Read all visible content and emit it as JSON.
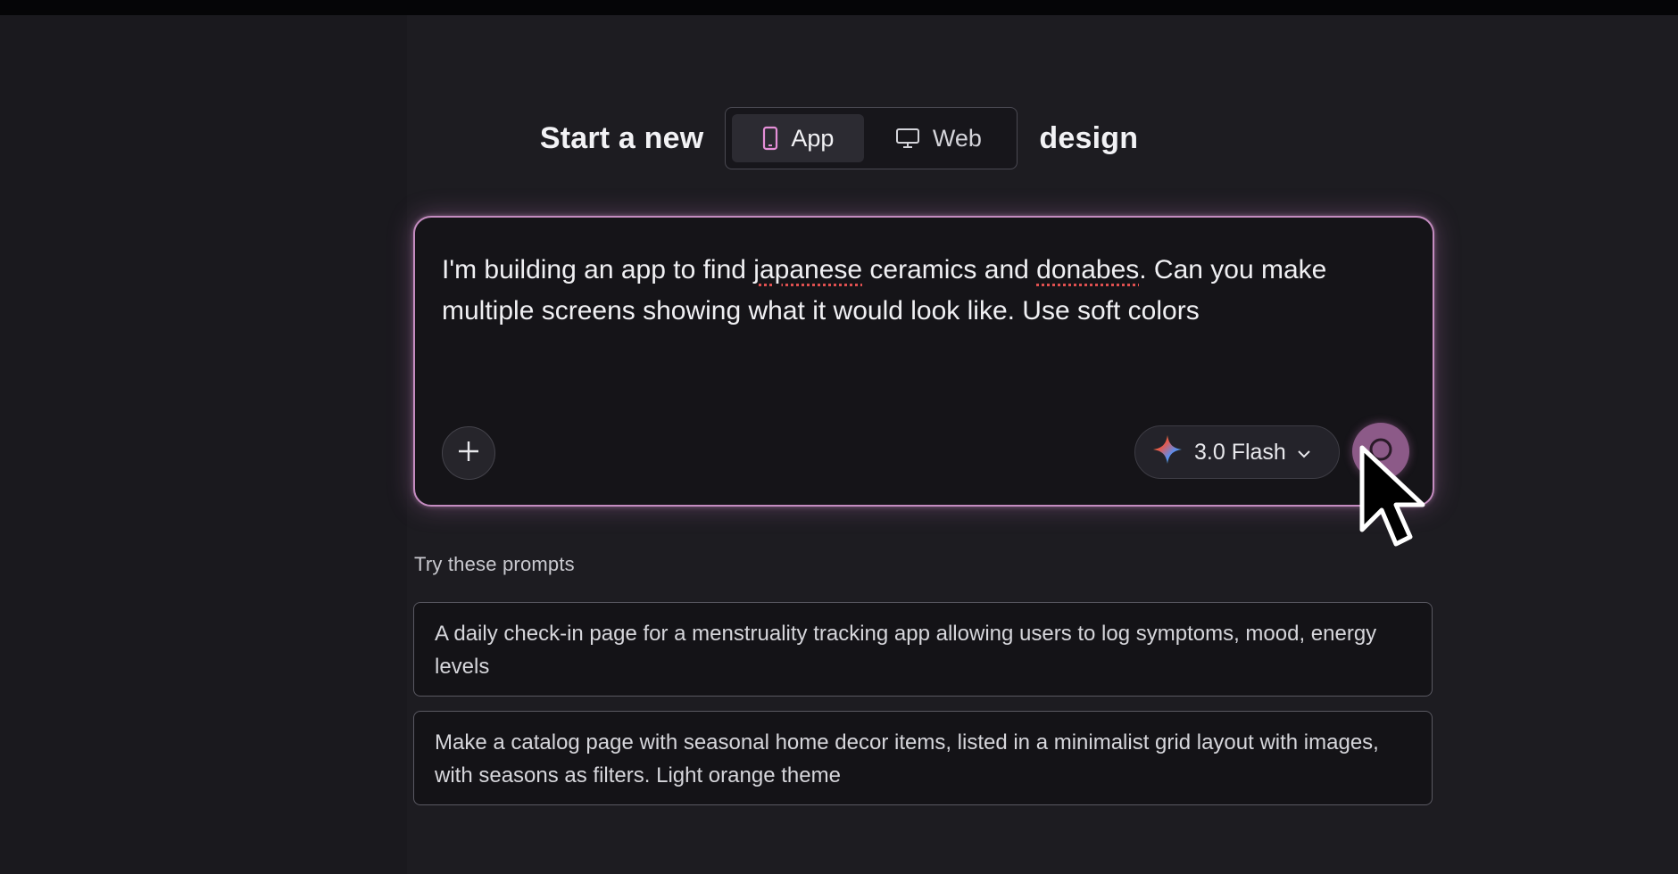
{
  "header": {
    "prefix": "Start a new",
    "suffix": "design",
    "toggle": [
      {
        "label": "App",
        "icon": "phone-icon",
        "active": true
      },
      {
        "label": "Web",
        "icon": "monitor-icon",
        "active": false
      }
    ]
  },
  "prompt": {
    "part1": "I'm building an app to find ",
    "spell1": "japanese",
    "part2": " ceramics and ",
    "spell2": "donabes",
    "part3": ". Can you make multiple screens showing what it would look like. Use soft colors",
    "add_icon": "plus-icon",
    "model_label": "3.0 Flash",
    "model_icon": "sparkle-icon",
    "send_icon": "send-icon"
  },
  "suggestions": {
    "title": "Try these prompts",
    "items": [
      "A daily check-in page for a menstruality tracking app allowing users to log symptoms, mood, energy levels",
      "Make a catalog page with seasonal home decor items, listed in a minimalist grid layout with images, with seasons as filters. Light orange theme"
    ]
  },
  "colors": {
    "background": "#1d1c21",
    "accent_border": "#c48cc0",
    "send_button": "#8c5a88"
  }
}
